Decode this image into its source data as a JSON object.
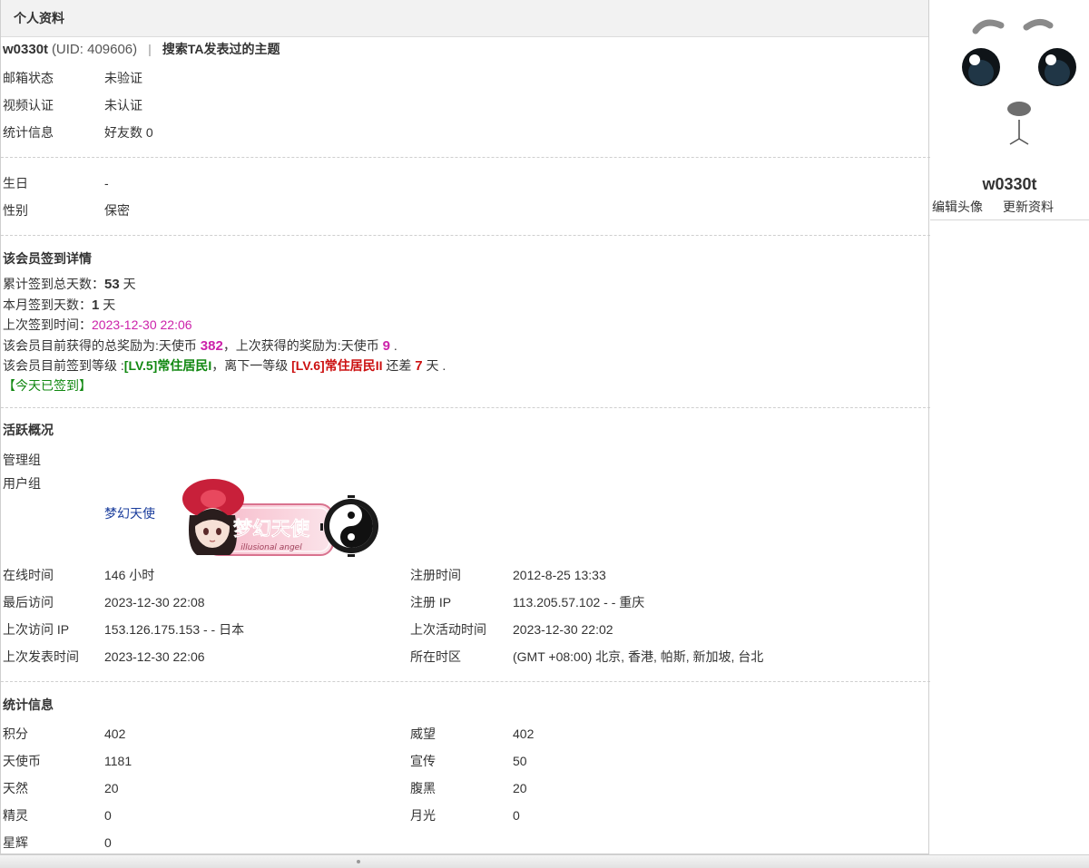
{
  "header": {
    "title": "个人资料"
  },
  "user": {
    "name": "w0330t",
    "uid_text": "(UID: 409606)",
    "separator": "|",
    "search_link": "搜索TA发表过的主题"
  },
  "basic": [
    {
      "label": "邮箱状态",
      "value": "未验证"
    },
    {
      "label": "视频认证",
      "value": "未认证"
    },
    {
      "label": "统计信息",
      "value": "好友数 0"
    }
  ],
  "personal": [
    {
      "label": "生日",
      "value": "-"
    },
    {
      "label": "性别",
      "value": "保密"
    }
  ],
  "signin": {
    "title": "该会员签到详情",
    "total_prefix": "累计签到总天数：",
    "total_days": "53",
    "day_unit": " 天",
    "month_prefix": "本月签到天数：",
    "month_days": "1",
    "last_prefix": "上次签到时间：",
    "last_time": "2023-12-30 22:06",
    "reward_prefix": "该会员目前获得的总奖励为:天使币 ",
    "reward_total": "382",
    "reward_mid": "，上次获得的奖励为:天使币 ",
    "reward_last": "9",
    "reward_end": " .",
    "level_prefix": "该会员目前签到等级 :",
    "level_current": "[LV.5]常住居民I",
    "level_mid": "，离下一等级 ",
    "level_next": "[LV.6]常住居民II",
    "level_gap_prefix": " 还差 ",
    "level_gap": "7",
    "level_end": " 天 .",
    "today": "【今天已签到】"
  },
  "activity": {
    "title": "活跃概况",
    "admin_group_label": "管理组",
    "user_group_label": "用户组",
    "user_group_value": "梦幻天使",
    "badge_text": "梦幻天使",
    "badge_subtext": "illusional angel",
    "left": [
      {
        "label": "在线时间",
        "value": "146 小时"
      },
      {
        "label": "最后访问",
        "value": "2023-12-30 22:08"
      },
      {
        "label": "上次访问 IP",
        "value": "153.126.175.153 - - 日本"
      },
      {
        "label": "上次发表时间",
        "value": "2023-12-30 22:06"
      }
    ],
    "right": [
      {
        "label": "注册时间",
        "value": "2012-8-25 13:33"
      },
      {
        "label": "注册 IP",
        "value": "113.205.57.102 - - 重庆"
      },
      {
        "label": "上次活动时间",
        "value": "2023-12-30 22:02"
      },
      {
        "label": "所在时区",
        "value": "(GMT +08:00) 北京, 香港, 帕斯, 新加坡, 台北"
      }
    ]
  },
  "stats": {
    "title": "统计信息",
    "left": [
      {
        "label": "积分",
        "value": "402"
      },
      {
        "label": "天使币",
        "value": "1181"
      },
      {
        "label": "天然",
        "value": "20"
      },
      {
        "label": "精灵",
        "value": "0"
      },
      {
        "label": "星辉",
        "value": "0"
      }
    ],
    "right": [
      {
        "label": "威望",
        "value": "402"
      },
      {
        "label": "宣传",
        "value": "50"
      },
      {
        "label": "腹黑",
        "value": "20"
      },
      {
        "label": "月光",
        "value": "0"
      }
    ]
  },
  "sidebar": {
    "name": "w0330t",
    "edit_avatar": "编辑头像",
    "update_profile": "更新资料"
  }
}
